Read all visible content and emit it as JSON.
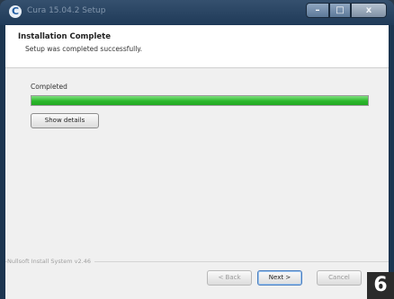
{
  "window": {
    "title": "Cura 15.04.2 Setup",
    "icon_letter": "C",
    "controls": {
      "minimize": "–",
      "maximize": "□",
      "close": "x"
    }
  },
  "header": {
    "title": "Installation Complete",
    "subtitle": "Setup was completed successfully."
  },
  "status": {
    "label": "Completed",
    "progress_fraction": 1.0,
    "progress_color": "#2cb82c"
  },
  "buttons": {
    "show_details": "Show details",
    "back": "< Back",
    "next": "Next >",
    "cancel": "Cancel"
  },
  "footer": {
    "branding": "Nullsoft Install System v2.46"
  },
  "badge": {
    "number": "6"
  }
}
